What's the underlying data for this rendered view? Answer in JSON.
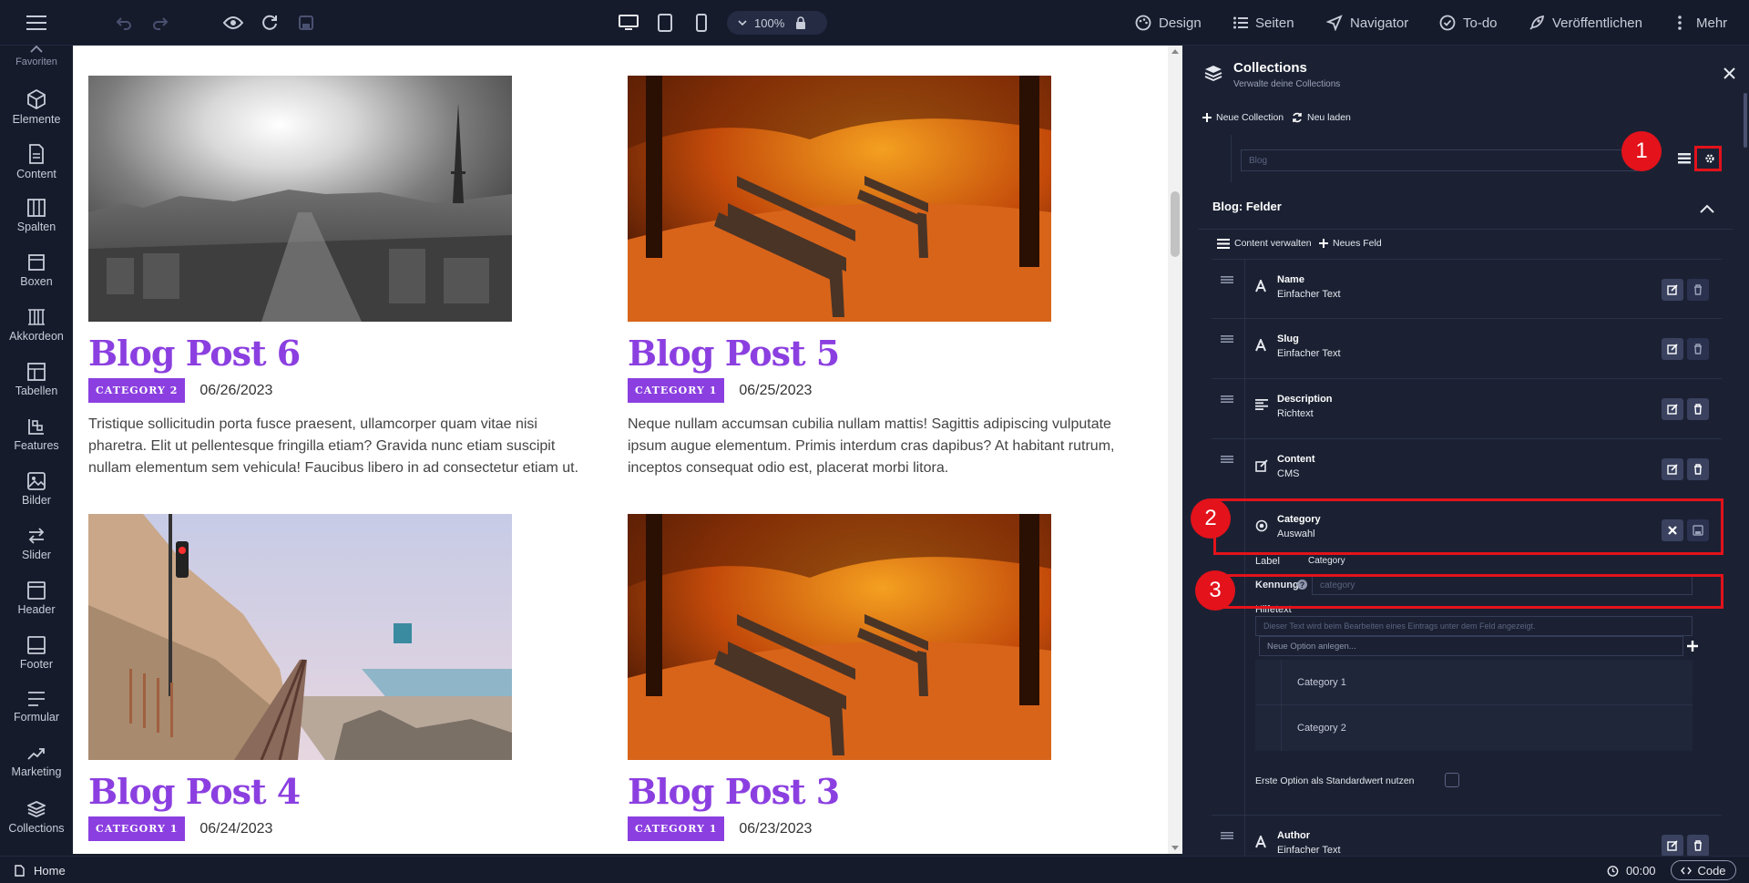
{
  "toolbar": {
    "zoom": "100%",
    "design": "Design",
    "pages": "Seiten",
    "navigator": "Navigator",
    "todo": "To-do",
    "publish": "Veröffentlichen",
    "more": "Mehr"
  },
  "sidebar": {
    "items": [
      {
        "label": "Favoriten",
        "icon": "star-icon"
      },
      {
        "label": "Elemente",
        "icon": "cube-icon"
      },
      {
        "label": "Content",
        "icon": "document-icon"
      },
      {
        "label": "Spalten",
        "icon": "columns-icon"
      },
      {
        "label": "Boxen",
        "icon": "box-icon"
      },
      {
        "label": "Akkordeon",
        "icon": "accordion-icon"
      },
      {
        "label": "Tabellen",
        "icon": "table-icon"
      },
      {
        "label": "Features",
        "icon": "features-icon"
      },
      {
        "label": "Bilder",
        "icon": "image-icon"
      },
      {
        "label": "Slider",
        "icon": "slider-icon"
      },
      {
        "label": "Header",
        "icon": "header-icon"
      },
      {
        "label": "Footer",
        "icon": "footer-icon"
      },
      {
        "label": "Formular",
        "icon": "form-icon"
      },
      {
        "label": "Marketing",
        "icon": "chart-up-icon"
      },
      {
        "label": "Collections",
        "icon": "layers-icon"
      }
    ]
  },
  "posts": [
    {
      "title": "Blog Post 6",
      "category": "Category 2",
      "date": "06/26/2023",
      "excerpt": "Tristique sollicitudin porta fusce praesent, ullamcorper quam vitae nisi pharetra. Elit ut pellentesque fringilla etiam? Gravida nunc etiam suscipit nullam elementum sem vehicula! Faucibus libero in ad consectetur etiam ut."
    },
    {
      "title": "Blog Post 5",
      "category": "Category 1",
      "date": "06/25/2023",
      "excerpt": "Neque nullam accumsan cubilia nullam mattis! Sagittis adipiscing vulputate ipsum augue elementum. Primis interdum cras dapibus? At habitant rutrum, inceptos consequat odio est, placerat morbi litora."
    },
    {
      "title": "Blog Post 4",
      "category": "Category 1",
      "date": "06/24/2023",
      "excerpt": ""
    },
    {
      "title": "Blog Post 3",
      "category": "Category 1",
      "date": "06/23/2023",
      "excerpt": ""
    }
  ],
  "panel": {
    "title": "Collections",
    "subtitle": "Verwalte deine Collections",
    "new_collection": "Neue Collection",
    "reload": "Neu laden",
    "collection_select": "Blog",
    "fields_heading": "Blog: Felder",
    "manage_content": "Content verwalten",
    "new_field": "Neues Feld",
    "fields": [
      {
        "name": "Name",
        "type": "Einfacher Text",
        "icon": "text-a-icon"
      },
      {
        "name": "Slug",
        "type": "Einfacher Text",
        "icon": "text-a-icon"
      },
      {
        "name": "Description",
        "type": "Richtext",
        "icon": "align-left-icon"
      },
      {
        "name": "Content",
        "type": "CMS",
        "icon": "edit-icon"
      },
      {
        "name": "Category",
        "type": "Auswahl",
        "icon": "radio-icon"
      },
      {
        "name": "Author",
        "type": "Einfacher Text",
        "icon": "text-a-icon"
      }
    ],
    "label_label": "Label",
    "label_value": "Category",
    "id_label": "Kennung",
    "id_placeholder": "category",
    "help_label": "Hilfetext",
    "help_placeholder": "Dieser Text wird beim Bearbeiten eines Eintrags unter dem Feld angezeigt.",
    "new_option_placeholder": "Neue Option anlegen...",
    "options": [
      "Category 1",
      "Category 2"
    ],
    "default_option_label": "Erste Option als Standardwert nutzen",
    "callouts": [
      "1",
      "2",
      "3"
    ]
  },
  "footer": {
    "home": "Home",
    "timer": "00:00",
    "code": "Code"
  },
  "colors": {
    "accent": "#8b3fe0",
    "highlight": "#e3121b",
    "panel_bg": "#1b2133",
    "chrome_bg": "#161b2c"
  }
}
